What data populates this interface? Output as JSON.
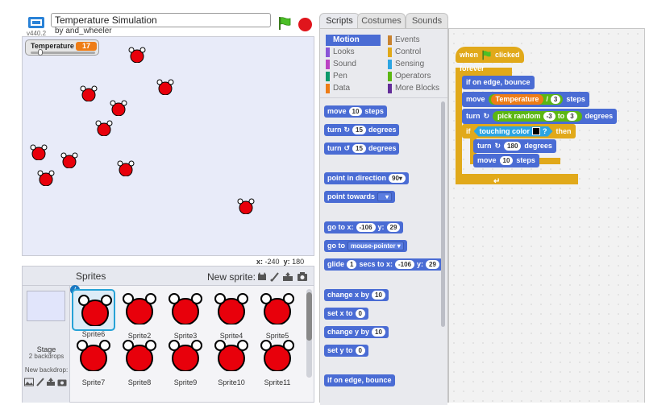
{
  "header": {
    "version": "v440.2",
    "project_title": "Temperature Simulation",
    "author": "by and_wheeler"
  },
  "stage": {
    "monitor": {
      "label": "Temperature",
      "value": "17",
      "slider_fraction": 0.12
    },
    "coords": {
      "x_label": "x:",
      "x_value": "-240",
      "y_label": "y:",
      "y_value": "180"
    }
  },
  "sprites": {
    "title": "Sprites",
    "new_sprite_label": "New sprite:",
    "stage_label": "Stage",
    "stage_backdrops": "2 backdrops",
    "new_backdrop_label": "New backdrop:",
    "info_glyph": "i",
    "items": [
      {
        "name": "Sprite6",
        "selected": true
      },
      {
        "name": "Sprite2"
      },
      {
        "name": "Sprite3"
      },
      {
        "name": "Sprite4"
      },
      {
        "name": "Sprite5"
      },
      {
        "name": "Sprite7"
      },
      {
        "name": "Sprite8"
      },
      {
        "name": "Sprite9"
      },
      {
        "name": "Sprite10"
      },
      {
        "name": "Sprite11"
      }
    ]
  },
  "tabs": {
    "scripts": "Scripts",
    "costumes": "Costumes",
    "sounds": "Sounds"
  },
  "palette": {
    "categories": {
      "motion": "Motion",
      "looks": "Looks",
      "sound": "Sound",
      "pen": "Pen",
      "data": "Data",
      "events": "Events",
      "control": "Control",
      "sensing": "Sensing",
      "operators": "Operators",
      "more": "More Blocks"
    },
    "colors": {
      "motion": "#4a6cd4",
      "looks": "#8a55d7",
      "sound": "#bb42c3",
      "pen": "#0e9a6c",
      "data": "#ee7d16",
      "events": "#c88330",
      "control": "#e1a91a",
      "sensing": "#2ca5e2",
      "operators": "#5cb712",
      "more": "#632d99"
    },
    "blocks": {
      "move": "move",
      "move_n": "10",
      "steps": "steps",
      "turn": "turn",
      "turn_cw_n": "15",
      "turn_ccw_n": "15",
      "degrees": "degrees",
      "point_dir": "point in direction",
      "point_dir_val": "90▾",
      "point_towards": "point towards",
      "point_towards_val": "▾",
      "goto_xy": "go to x:",
      "goto_x": "-106",
      "y_label": "y:",
      "goto_y": "29",
      "goto": "go to",
      "goto_val": "mouse-pointer ▾",
      "glide": "glide",
      "glide_secs": "1",
      "secs_to_x": "secs to x:",
      "glide_x": "-106",
      "glide_y": "29",
      "change_x": "change x by",
      "change_x_n": "10",
      "set_x": "set x to",
      "set_x_n": "0",
      "change_y": "change y by",
      "change_y_n": "10",
      "set_y": "set y to",
      "set_y_n": "0",
      "edge_bounce": "if on edge, bounce"
    }
  },
  "script": {
    "when": "when",
    "clicked": "clicked",
    "forever": "forever",
    "bounce": "if on edge, bounce",
    "move": "move",
    "temp_var": "Temperature",
    "divide": "/",
    "divisor": "3",
    "steps": "steps",
    "turn": "turn",
    "pick_random": "pick random",
    "rand_from": "-3",
    "to": "to",
    "rand_to": "3",
    "degrees": "degrees",
    "if": "if",
    "touching_color": "touching color",
    "q": "?",
    "then": "then",
    "turn2": "turn",
    "turn2_n": "180",
    "degrees2": "degrees",
    "move2": "move",
    "move2_n": "10",
    "steps2": "steps"
  }
}
